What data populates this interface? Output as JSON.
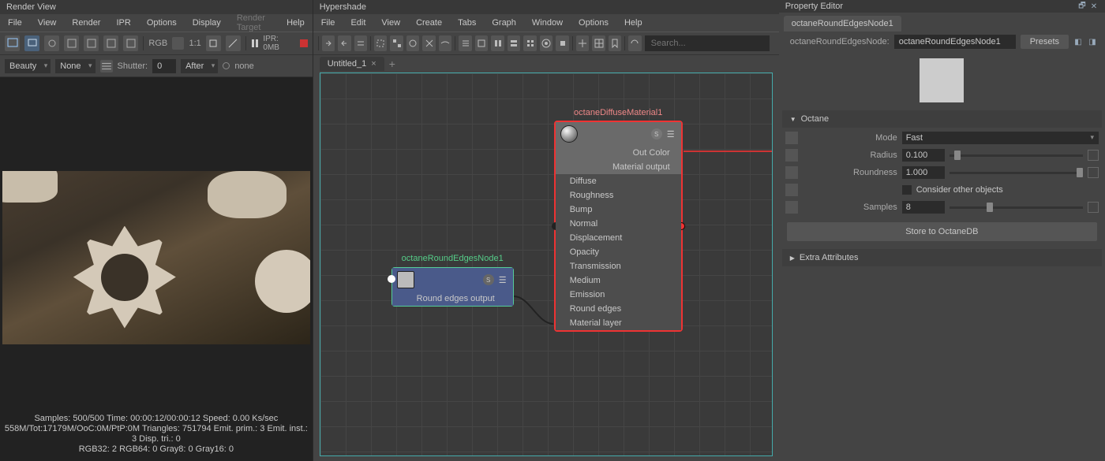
{
  "render_view": {
    "title": "Render View",
    "menu": [
      "File",
      "View",
      "Render",
      "IPR",
      "Options",
      "Display",
      "Render Target",
      "Help"
    ],
    "rgb_label": "RGB",
    "ratio": "1:1",
    "ipr_text": "IPR: 0MB",
    "beauty": "Beauty",
    "none": "None",
    "shutter_label": "Shutter:",
    "shutter_val": "0",
    "after": "After",
    "none2": "none",
    "stats": [
      "Samples: 500/500 Time: 00:00:12/00:00:12 Speed: 0.00 Ks/sec",
      "558M/Tot:17179M/OoC:0M/PtP:0M Triangles: 751794 Emit. prim.: 3 Emit. inst.: 3 Disp. tri.: 0",
      "RGB32: 2 RGB64: 0 Gray8: 0 Gray16: 0"
    ]
  },
  "hypershade": {
    "title": "Hypershade",
    "menu": [
      "File",
      "Edit",
      "View",
      "Create",
      "Tabs",
      "Graph",
      "Window",
      "Options",
      "Help"
    ],
    "search_ph": "Search...",
    "tab": "Untitled_1",
    "node_round": {
      "title": "octaneRoundEdgesNode1",
      "output": "Round edges output"
    },
    "node_diffuse": {
      "title": "octaneDiffuseMaterial1",
      "out_color": "Out Color",
      "mat_out": "Material output",
      "attrs": [
        "Diffuse",
        "Roughness",
        "Bump",
        "Normal",
        "Displacement",
        "Opacity",
        "Transmission",
        "Medium",
        "Emission",
        "Round edges",
        "Material layer"
      ]
    }
  },
  "property_editor": {
    "title": "Property Editor",
    "tab": "octaneRoundEdgesNode1",
    "field_label": "octaneRoundEdgesNode:",
    "field_value": "octaneRoundEdgesNode1",
    "presets": "Presets",
    "section_octane": "Octane",
    "mode_label": "Mode",
    "mode_value": "Fast",
    "radius_label": "Radius",
    "radius_value": "0.100",
    "roundness_label": "Roundness",
    "roundness_value": "1.000",
    "consider_label": "Consider other objects",
    "samples_label": "Samples",
    "samples_value": "8",
    "store_btn": "Store to OctaneDB",
    "extra_attrs": "Extra Attributes"
  }
}
